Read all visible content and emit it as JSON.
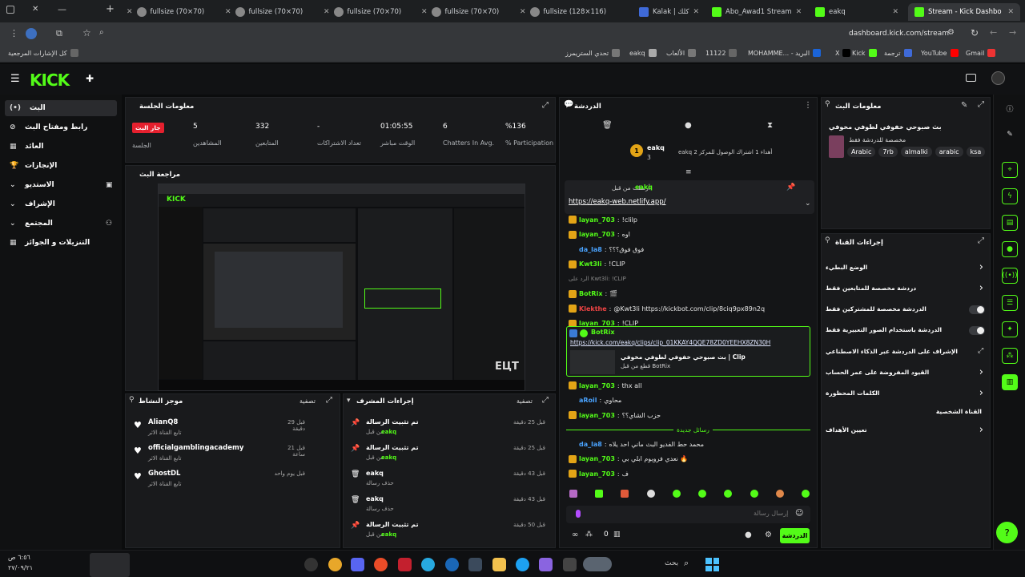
{
  "browser": {
    "tabs": [
      {
        "label": "fullsize (70×70)",
        "icon": "globe-icon"
      },
      {
        "label": "fullsize (70×70)",
        "icon": "globe-icon"
      },
      {
        "label": "fullsize (70×70)",
        "icon": "globe-icon"
      },
      {
        "label": "fullsize (70×70)",
        "icon": "globe-icon"
      },
      {
        "label": "fullsize (128×116)",
        "icon": "globe-icon"
      },
      {
        "label": "Kalak | كلك",
        "icon": "kalak-icon"
      },
      {
        "label": "Abo_Awad1 Stream",
        "icon": "kick-icon"
      },
      {
        "label": "eakq",
        "icon": "kick-icon"
      },
      {
        "label": "Stream - Kick Dashbo",
        "icon": "kick-icon"
      }
    ],
    "url": "dashboard.kick.com/stream",
    "bookmarks": [
      "كل الإشارات المرجعية",
      "تحدي الستريمرز",
      "eakq",
      "الألعاب",
      "11122",
      "MOHAMME... - البريد",
      "X",
      "Kick",
      "ترجمة",
      "YouTube",
      "Gmail"
    ]
  },
  "sidebar": {
    "items": [
      "البث",
      "رابط ومفتاح البث",
      "العائد",
      "الإنجازات",
      "الاستديو",
      "الإشراف",
      "المجتمع",
      "التنزيلات و الجوائز"
    ]
  },
  "session": {
    "title": "معلومات الجلسة",
    "live_badge": "جار البث",
    "session_label": "الجلسة",
    "stats": [
      {
        "value": "5",
        "label": "المشاهدين"
      },
      {
        "value": "332",
        "label": "المتابعين"
      },
      {
        "value": "-",
        "label": "تعداد الاشتراكات"
      },
      {
        "value": "01:05:55",
        "label": "الوقت مباشر"
      },
      {
        "value": "6",
        "label": "Chatters In Avg."
      },
      {
        "value": "%136",
        "label": "% Participation"
      }
    ]
  },
  "preview": {
    "title": "مراجعة البث"
  },
  "activity": {
    "title": "موجز النشاط",
    "filter": "تصفية",
    "items": [
      {
        "name": "AlianQ8",
        "sub": "تابع القناة الاثر",
        "time": "قبل 29 دقيقة"
      },
      {
        "name": "officialgamblingacademy",
        "sub": "تابع القناة الاثر",
        "time": "قبل 21 ساعة"
      },
      {
        "name": "GhostDL",
        "sub": "تابع القناة الاثر",
        "time": "قبل يوم واحد"
      }
    ]
  },
  "modactions": {
    "title": "إجراءات المشرف",
    "filter": "تصفية",
    "items": [
      {
        "name": "تم تثبيت الرسالة",
        "sub": "من قبل",
        "by": "eakq",
        "time": "قبل 25 دقيقة"
      },
      {
        "name": "تم تثبيت الرسالة",
        "sub": "من قبل",
        "by": "eakq",
        "time": "قبل 25 دقيقة"
      },
      {
        "name": "eakq",
        "sub": "حذف رسالة",
        "by": "",
        "time": "قبل 43 دقيقة"
      },
      {
        "name": "eakq",
        "sub": "حذف رسالة",
        "by": "",
        "time": "قبل 43 دقيقة"
      },
      {
        "name": "تم تثبيت الرسالة",
        "sub": "من قبل",
        "by": "eakq",
        "time": "قبل 50 دقيقة"
      }
    ]
  },
  "chat": {
    "title": "الدردشة",
    "top_user": "eakq",
    "top_count": "3",
    "top_rank": "1",
    "top_text": "أهداء 1 اشتراك الوصول للمركز 2 eakq",
    "pinned_by": "أرسلت من قبل",
    "pinned_user": "eakq",
    "pinned_link": "https://eakq-web.netlify.app/",
    "messages": [
      {
        "user": "layan_703",
        "text": "!clilp",
        "color": "green"
      },
      {
        "user": "layan_703",
        "text": "اوه",
        "color": "green"
      },
      {
        "user": "da_la8",
        "text": "فوق فوق؟؟؟",
        "color": "blue"
      },
      {
        "user": "Kwt3li",
        "text": "!CLIP",
        "color": "green"
      },
      {
        "user": "",
        "text": "الرد على Kwt3li: !CLIP",
        "color": "grey"
      },
      {
        "user": "BotRix",
        "text": "🎬",
        "color": "green"
      },
      {
        "user": "Klekthe",
        "text": "@Kwt3li https://kickbot.com/clip/8ciq9px89n2q",
        "color": "red"
      },
      {
        "user": "layan_703",
        "text": "!CLIP",
        "color": "green"
      }
    ],
    "clip_user": "BotRix",
    "clip_link": "https://kick.com/eakq/clips/clip_01KKAY4QQE78ZD0YEEHX8ZN30H",
    "clip_title": "بث صبوحي خفوفي لطوفي مخوفي | Clip",
    "clip_sub": "قطع من قبل BotRix",
    "messages2": [
      {
        "user": "layan_703",
        "text": "thx all",
        "color": "green"
      },
      {
        "user": "aRoil",
        "text": "محاوي",
        "color": "blue"
      },
      {
        "user": "layan_703",
        "text": "حزب الشاي؟؟",
        "color": "green"
      }
    ],
    "new_messages": "رسائل جديدة",
    "messages3": [
      {
        "user": "da_la8",
        "text": "محمد حط الفديو البث ماني احد يلاه",
        "color": "blue"
      },
      {
        "user": "layan_703",
        "text": "نعدي فرويوم ابلي بي 🔥",
        "color": "green"
      },
      {
        "user": "layan_703",
        "text": "ف",
        "color": "green"
      }
    ],
    "input_placeholder": "إرسال رسالة",
    "points": "0",
    "send_label": "الدردشة"
  },
  "streaminfo": {
    "title": "معلومات البث",
    "stream_title": "بث صبوحي خفوفي لطوفي مخوفي",
    "category": "مخصصة للدردشة فقط",
    "tags": [
      "Arabic",
      "7rb",
      "almalki",
      "arabic",
      "ksa"
    ]
  },
  "channelactions": {
    "title": "إجراءات القناة",
    "items": [
      {
        "label": "الوضع البطيء",
        "kind": "arrow"
      },
      {
        "label": "دردشة مخصصة للمتابعين فقط",
        "kind": "arrow"
      },
      {
        "label": "الدردشة مخصصة للمشتركين فقط",
        "kind": "toggle"
      },
      {
        "label": "الدردشة باستخدام الصور التعبيرية فقط",
        "kind": "toggle"
      },
      {
        "label": "الإشراف على الدردشة عبر الذكاء الاصطناعي",
        "kind": "ext"
      },
      {
        "label": "القيود المفروضة على عمر الحساب",
        "kind": "arrow"
      },
      {
        "label": "الكلمات المحظورة",
        "kind": "arrow"
      },
      {
        "label": "القناة الشخصية",
        "kind": "head"
      },
      {
        "label": "تعيين الأهداف",
        "kind": "arrow"
      }
    ]
  },
  "taskbar": {
    "search": "بحث",
    "time": "٦:٥٦ ص",
    "date": "٢٧/٠٩/٢١"
  },
  "colors": {
    "accent": "#53fc18",
    "live": "#e5202e"
  }
}
